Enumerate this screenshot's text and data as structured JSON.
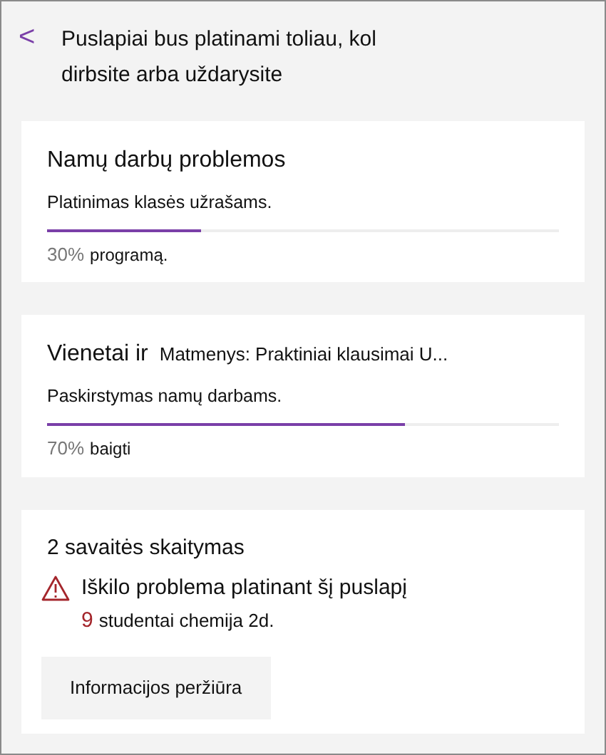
{
  "header": {
    "back_icon": "<",
    "title": "Puslapiai bus platinami toliau, kol dirbsite arba uždarysite"
  },
  "cards": [
    {
      "kind": "progress",
      "title": "Namų darbų problemos",
      "subtitle": "Platinimas klasės užrašams.",
      "level": 0.3,
      "percent": "30%",
      "status": "programą."
    },
    {
      "kind": "progress",
      "title": "Vienetai ir",
      "title_extra": "Matmenys: Praktiniai klausimai U...",
      "subtitle": "Paskirstymas namų darbams.",
      "level": 0.7,
      "percent": "70%",
      "status": "baigti"
    },
    {
      "kind": "error",
      "title": "2 savaitės skaitymas",
      "message": "Iškilo problema platinant šį puslapį",
      "count": "9",
      "detail": "studentai chemija 2d.",
      "button": "Informacijos peržiūra"
    }
  ]
}
